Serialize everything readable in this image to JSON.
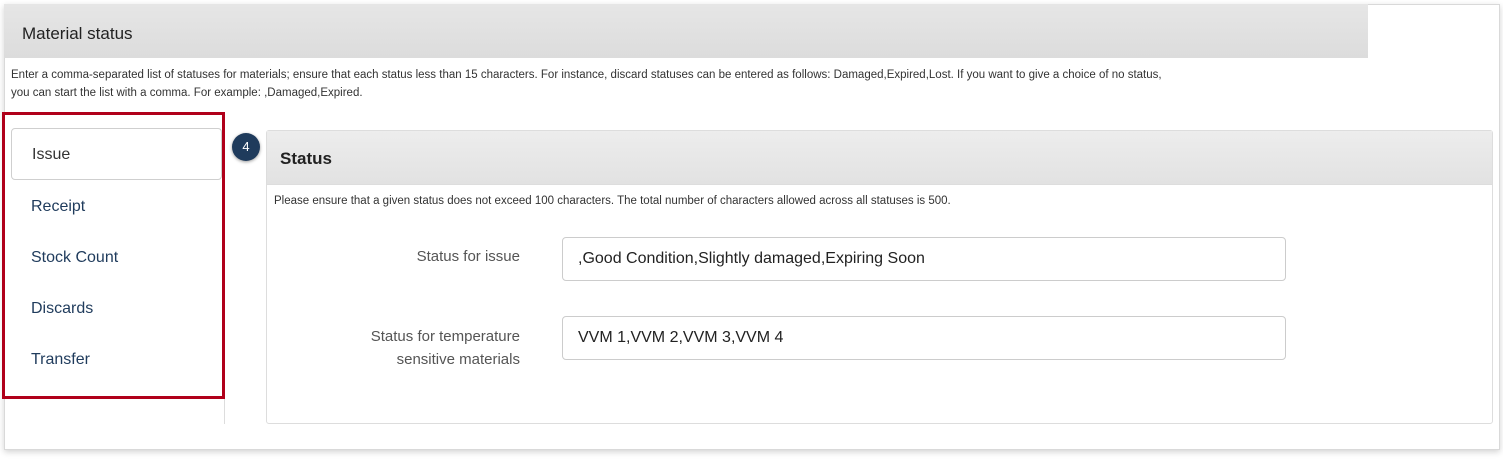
{
  "section": {
    "title": "Material status",
    "description_line1": "Enter a comma-separated list of statuses for materials; ensure that each status less than 15 characters. For instance, discard statuses can be entered as follows: Damaged,Expired,Lost. If you want to give a choice of no status,",
    "description_line2": "you can start the list with a comma. For example: ,Damaged,Expired."
  },
  "sidebar": {
    "items": [
      {
        "label": "Issue",
        "active": true
      },
      {
        "label": "Receipt",
        "active": false
      },
      {
        "label": "Stock Count",
        "active": false
      },
      {
        "label": "Discards",
        "active": false
      },
      {
        "label": "Transfer",
        "active": false
      }
    ]
  },
  "step_badge": "4",
  "panel": {
    "title": "Status",
    "help_text": "Please ensure that a given status does not exceed 100 characters. The total number of characters allowed across all statuses is 500.",
    "fields": [
      {
        "label": "Status for issue",
        "value": ",Good Condition,Slightly damaged,Expiring Soon"
      },
      {
        "label_line1": "Status for temperature",
        "label_line2": "sensitive materials",
        "value": "VVM 1,VVM 2,VVM 3,VVM 4"
      }
    ]
  },
  "colors": {
    "highlight": "#b0001a",
    "badge": "#1f3b5c",
    "link": "#1f3b5c"
  }
}
